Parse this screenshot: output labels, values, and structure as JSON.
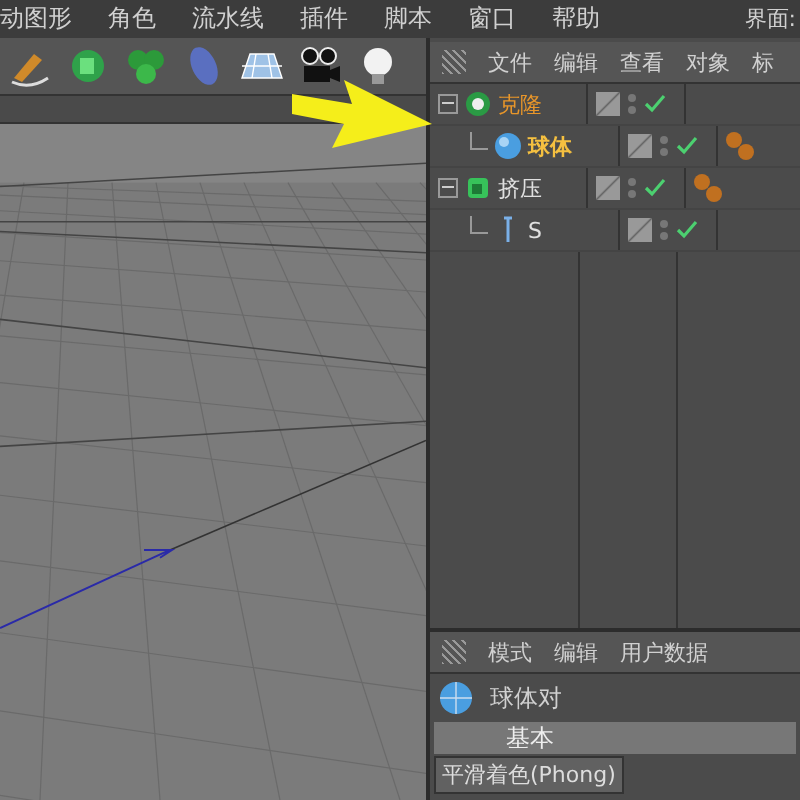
{
  "menu_bar": {
    "items": [
      "动图形",
      "角色",
      "流水线",
      "插件",
      "脚本",
      "窗口",
      "帮助"
    ],
    "layout_label": "界面:"
  },
  "toolbar": {
    "tools": [
      {
        "kind": "pen"
      },
      {
        "kind": "cloner"
      },
      {
        "kind": "clover"
      },
      {
        "kind": "deformer"
      },
      {
        "kind": "floor"
      },
      {
        "kind": "camera"
      },
      {
        "kind": "light"
      }
    ]
  },
  "object_manager": {
    "menu": [
      "文件",
      "编辑",
      "查看",
      "对象",
      "标"
    ],
    "tree": [
      {
        "name": "克隆",
        "kind": "cloner",
        "selected": true,
        "expanded": true,
        "enabled": true,
        "phong_tag": false,
        "children": [
          {
            "name": "球体",
            "kind": "sphere",
            "selected": true,
            "enabled": true,
            "phong_tag": true
          }
        ]
      },
      {
        "name": "挤压",
        "kind": "extrude",
        "selected": false,
        "expanded": true,
        "enabled": true,
        "phong_tag": true,
        "children": [
          {
            "name": "S",
            "kind": "text",
            "selected": false,
            "enabled": true,
            "phong_tag": false
          }
        ]
      }
    ]
  },
  "attribute_manager": {
    "menu": [
      "模式",
      "编辑",
      "用户数据"
    ],
    "object_title": "球体对",
    "tabs": [
      {
        "label": "基本",
        "selected": true
      }
    ],
    "tag_button": "平滑着色(Phong)"
  }
}
